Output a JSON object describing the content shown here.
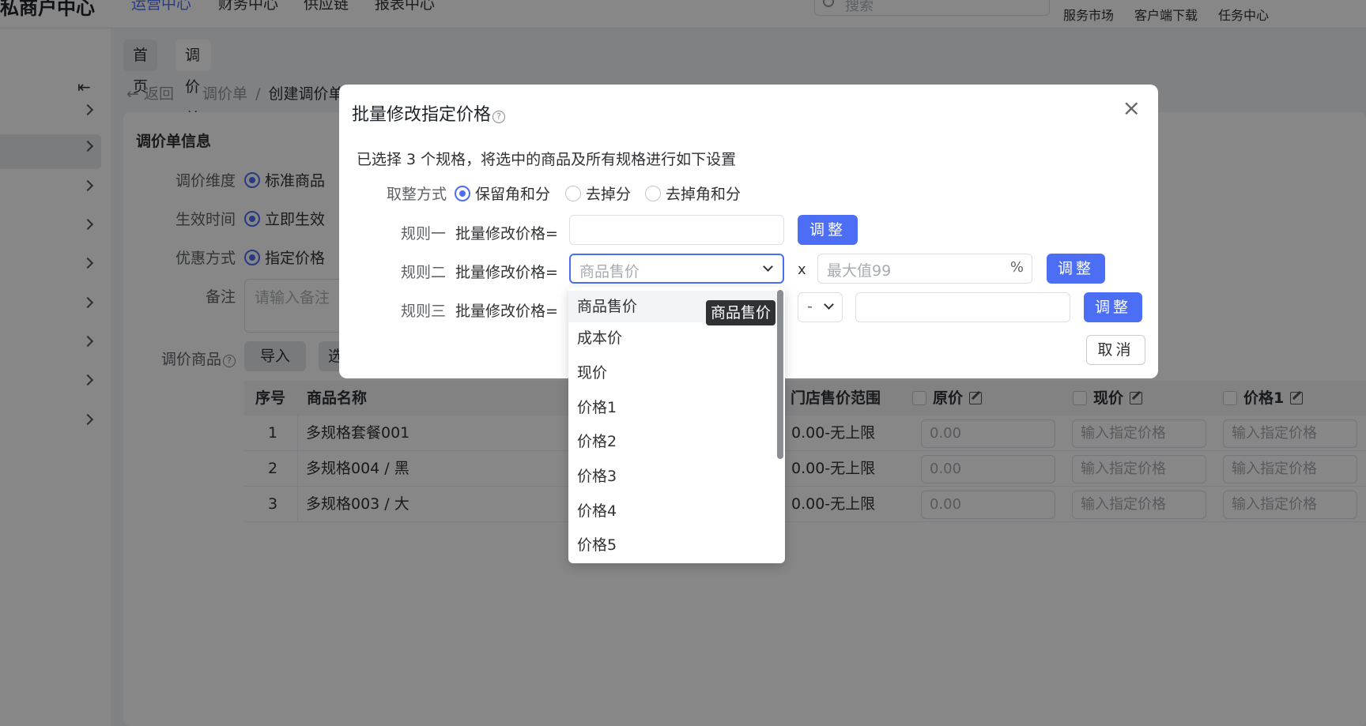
{
  "app": {
    "brand": "私商户中心",
    "nav": [
      "运营中心",
      "财务中心",
      "供应链",
      "报表中心"
    ],
    "search_placeholder": "搜索",
    "top_links": [
      "服务市场",
      "客户端下载",
      "任务中心"
    ]
  },
  "tabs": [
    {
      "label": "首页"
    },
    {
      "label": "调价单",
      "close": "×"
    }
  ],
  "breadcrumb": {
    "back": "返回",
    "items": [
      "调价单",
      "/",
      "创建调价单"
    ]
  },
  "form": {
    "section_title": "调价单信息",
    "dimension_label": "调价维度",
    "dimension_value": "标准商品",
    "effective_label": "生效时间",
    "effective_value": "立即生效",
    "discount_label": "优惠方式",
    "discount_value": "指定价格",
    "remark_label": "备注",
    "remark_placeholder": "请输入备注",
    "goods_label": "调价商品",
    "import_btn": "导入",
    "select_btn": "选"
  },
  "table": {
    "headers": [
      "序号",
      "商品名称",
      "门店售价范围",
      "原价",
      "现价",
      "价格1"
    ],
    "rows": [
      {
        "no": "1",
        "name": "多规格套餐001",
        "range": "0.00-无上限",
        "orig": "0.00",
        "cur": "输入指定价格",
        "p1": "输入指定价格"
      },
      {
        "no": "2",
        "name": "多规格004 / 黑",
        "range": "0.00-无上限",
        "orig": "0.00",
        "cur": "输入指定价格",
        "p1": "输入指定价格"
      },
      {
        "no": "3",
        "name": "多规格003 / 大",
        "range": "0.00-无上限",
        "orig": "0.00",
        "cur": "输入指定价格",
        "p1": "输入指定价格"
      }
    ]
  },
  "modal": {
    "title": "批量修改指定价格",
    "close": "×",
    "description": "已选择 3 个规格，将选中的商品及所有规格进行如下设置",
    "rounding_label": "取整方式",
    "rounding_options": [
      "保留角和分",
      "去掉分",
      "去掉角和分"
    ],
    "rules": [
      {
        "label": "规则一",
        "prefix": "批量修改价格="
      },
      {
        "label": "规则二",
        "prefix": "批量修改价格=",
        "select_placeholder": "商品售价",
        "times": "x",
        "max_placeholder": "最大值99",
        "suffix": "%"
      },
      {
        "label": "规则三",
        "prefix": "批量修改价格=",
        "operator": "-"
      }
    ],
    "adjust_btn": "调整",
    "cancel_btn": "取消"
  },
  "dropdown": {
    "options": [
      "商品售价",
      "成本价",
      "现价",
      "价格1",
      "价格2",
      "价格3",
      "价格4",
      "价格5"
    ],
    "tooltip": "商品售价"
  },
  "colors": {
    "primary": "#4c6ef5",
    "mask": "rgba(0,0,0,0.47)"
  }
}
